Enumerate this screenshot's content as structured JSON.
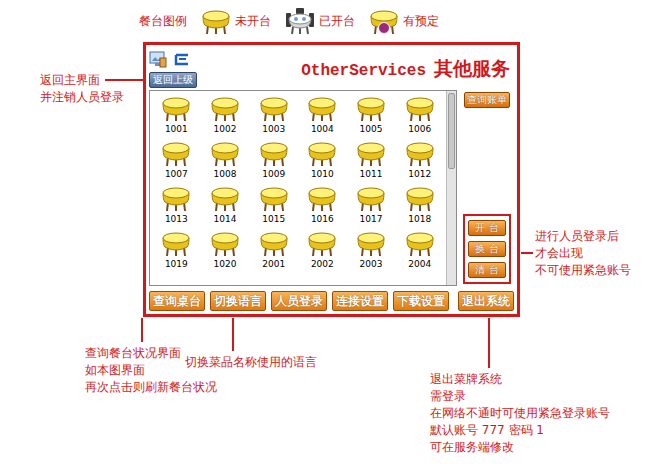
{
  "legend": {
    "label": "餐台图例",
    "items": [
      {
        "label": "未开台",
        "status": "free"
      },
      {
        "label": "已开台",
        "status": "open"
      },
      {
        "label": "有预定",
        "status": "reserved"
      }
    ]
  },
  "window": {
    "title_en": "OtherServices",
    "title_zh": "其他服务",
    "back_button": "返回上级"
  },
  "tables": [
    {
      "number": "1001",
      "status": "free"
    },
    {
      "number": "1002",
      "status": "free"
    },
    {
      "number": "1003",
      "status": "free"
    },
    {
      "number": "1004",
      "status": "free"
    },
    {
      "number": "1005",
      "status": "free"
    },
    {
      "number": "1006",
      "status": "free"
    },
    {
      "number": "1007",
      "status": "free"
    },
    {
      "number": "1008",
      "status": "free"
    },
    {
      "number": "1009",
      "status": "free"
    },
    {
      "number": "1010",
      "status": "free"
    },
    {
      "number": "1011",
      "status": "free"
    },
    {
      "number": "1012",
      "status": "free"
    },
    {
      "number": "1013",
      "status": "free"
    },
    {
      "number": "1014",
      "status": "free"
    },
    {
      "number": "1015",
      "status": "free"
    },
    {
      "number": "1016",
      "status": "free"
    },
    {
      "number": "1017",
      "status": "free"
    },
    {
      "number": "1018",
      "status": "free"
    },
    {
      "number": "1019",
      "status": "free"
    },
    {
      "number": "1020",
      "status": "free"
    },
    {
      "number": "2001",
      "status": "free"
    },
    {
      "number": "2002",
      "status": "free"
    },
    {
      "number": "2003",
      "status": "free"
    },
    {
      "number": "2004",
      "status": "free"
    }
  ],
  "scrollbar": {
    "level": 0.4
  },
  "side_buttons": {
    "bill": "查询账单",
    "staff": [
      "开 台",
      "换 台",
      "清 台"
    ]
  },
  "toolbar": [
    "查询桌台",
    "切换语言",
    "人员登录",
    "连接设置",
    "下载设置"
  ],
  "exit_button": "退出系统",
  "notes": {
    "back": [
      "返回主界面",
      "并注销人员登录"
    ],
    "staff": [
      "进行人员登录后",
      "才会出现",
      "不可使用紧急账号"
    ],
    "tables": [
      "查询餐台状况界面",
      "如本图界面",
      "再次点击则刷新餐台状况"
    ],
    "language": [
      "切换菜品名称使用的语言"
    ],
    "exit": [
      "退出菜牌系统",
      "需登录",
      "在网络不通时可使用紧急登录账号",
      "默认账号 777 密码 1",
      "可在服务端修改"
    ]
  }
}
